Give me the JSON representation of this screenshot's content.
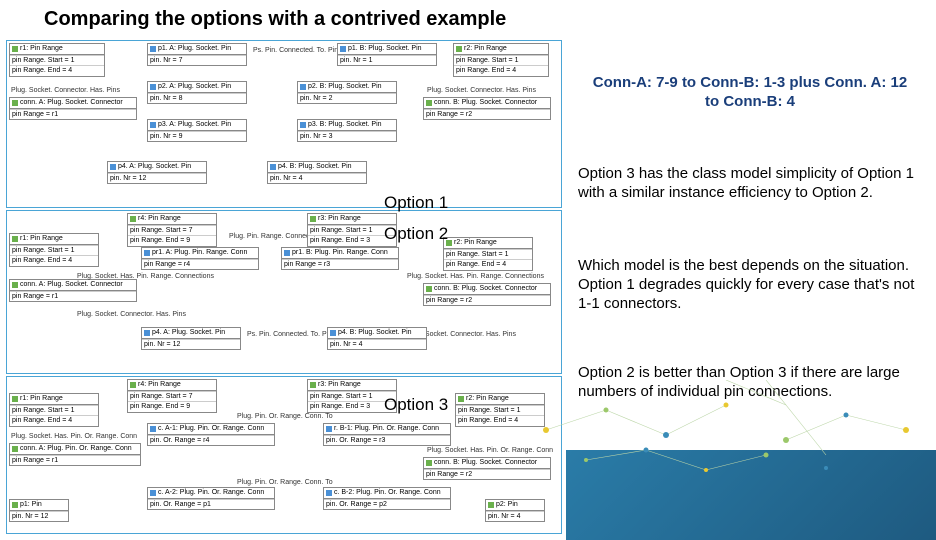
{
  "title": "Comparing the options with a contrived example",
  "summary": "Conn-A: 7-9 to Conn-B: 1-3 plus Conn. A: 12 to Conn-B: 4",
  "paragraph1": "Option 3 has the class model simplicity of Option 1 with a similar instance efficiency to Option 2.",
  "paragraph2": "Which model is the best depends on the situation. Option 1 degrades quickly for every case that's not 1-1 connectors.",
  "paragraph3": "Option 2 is better than Option 3 if there are large numbers of individual pin connections.",
  "option1": "Option 1",
  "option2": "Option 2",
  "option3": "Option 3",
  "diagrams": {
    "d1": {
      "r1": {
        "name": "r1: Pin Range",
        "slots": [
          "pin Range. Start = 1",
          "pin Range. End = 4"
        ]
      },
      "assoc1": "Plug. Socket. Connector. Has. Pins",
      "connA": {
        "name": "conn. A: Plug. Socket. Connector",
        "slot": "pin Range = r1"
      },
      "p1A": {
        "name": "p1. A: Plug. Socket. Pin",
        "slot": "pin. Nr = 7"
      },
      "p2A": {
        "name": "p2. A: Plug. Socket. Pin",
        "slot": "pin. Nr = 8"
      },
      "p3A": {
        "name": "p3. A: Plug. Socket. Pin",
        "slot": "pin. Nr = 9"
      },
      "p4A": {
        "name": "p4. A: Plug. Socket. Pin",
        "slot": "pin. Nr = 12"
      },
      "r2": {
        "name": "r2: Pin Range",
        "slots": [
          "pin Range. Start = 1",
          "pin Range. End = 4"
        ]
      },
      "assoc_mid": "Ps. Pin. Connected. To. Pin",
      "p1B": {
        "name": "p1. B: Plug. Socket. Pin",
        "slot": "pin. Nr = 1"
      },
      "p2B": {
        "name": "p2. B: Plug. Socket. Pin",
        "slot": "pin. Nr = 2"
      },
      "p3B": {
        "name": "p3. B: Plug. Socket. Pin",
        "slot": "pin. Nr = 3"
      },
      "p4B": {
        "name": "p4. B: Plug. Socket. Pin",
        "slot": "pin. Nr = 4"
      },
      "assoc2": "Plug. Socket. Connector. Has. Pins",
      "connB": {
        "name": "conn. B: Plug. Socket. Connector",
        "slot": "pin Range = r2"
      }
    },
    "d2": {
      "r1": {
        "name": "r1: Pin Range",
        "slots": [
          "pin Range. Start = 1",
          "pin Range. End = 4"
        ]
      },
      "connA": {
        "name": "conn. A: Plug. Socket. Connector",
        "slot": "pin Range = r1"
      },
      "r4": {
        "name": "r4: Pin Range",
        "slots": [
          "pin Range. Start = 7",
          "pin Range. End = 9"
        ]
      },
      "pr1A": {
        "name": "pr1. A: Plug. Pin. Range. Conn",
        "slot": "pin Range = r4"
      },
      "r3": {
        "name": "r3: Pin Range",
        "slots": [
          "pin Range. Start = 1",
          "pin Range. End = 3"
        ]
      },
      "pr1B": {
        "name": "pr1. B: Plug. Pin. Range. Conn",
        "slot": "pin Range = r3"
      },
      "r2": {
        "name": "r2: Pin Range",
        "slots": [
          "pin Range. Start = 1",
          "pin Range. End = 4"
        ]
      },
      "connB": {
        "name": "conn. B: Plug. Socket. Connector",
        "slot": "pin Range = r2"
      },
      "p4A": {
        "name": "p4. A: Plug. Socket. Pin",
        "slot": "pin. Nr = 12"
      },
      "p4B": {
        "name": "p4. B: Plug. Socket. Pin",
        "slot": "pin. Nr = 4"
      },
      "assoc_top": "Plug. Pin. Range. Connected. To. Range",
      "assoc_has_l": "Plug. Socket. Has. Pin. Range. Connections",
      "assoc_has_r": "Plug. Socket. Has. Pin. Range. Connections",
      "assoc_haspins_l": "Plug. Socket. Connector. Has. Pins",
      "assoc_haspins_r": "Plug. Socket. Connector. Has. Pins",
      "assoc_ps": "Ps. Pin. Connected. To. Pin"
    },
    "d3": {
      "r1": {
        "name": "r1: Pin Range",
        "slots": [
          "pin Range. Start = 1",
          "pin Range. End = 4"
        ]
      },
      "connA": {
        "name": "conn. A: Plug. Pin. Or. Range. Conn",
        "slot": "pin Range = r1"
      },
      "r4": {
        "name": "r4: Pin Range",
        "slots": [
          "pin Range. Start = 7",
          "pin Range. End = 9"
        ]
      },
      "cA1": {
        "name": "c. A-1: Plug. Pin. Or. Range. Conn",
        "slot": "pin. Or. Range = r4"
      },
      "r3": {
        "name": "r3: Pin Range",
        "slots": [
          "pin Range. Start = 1",
          "pin Range. End = 3"
        ]
      },
      "rB1": {
        "name": "r. B-1: Plug. Pin. Or. Range. Conn",
        "slot": "pin. Or. Range = r3"
      },
      "r2": {
        "name": "r2: Pin Range",
        "slots": [
          "pin Range. Start = 1",
          "pin Range. End = 4"
        ]
      },
      "connB": {
        "name": "conn. B: Plug. Socket. Connector",
        "slot": "pin Range = r2"
      },
      "cA2": {
        "name": "c. A-2: Plug. Pin. Or. Range. Conn",
        "slot": "pin. Or. Range = p1"
      },
      "cB2": {
        "name": "c. B-2: Plug. Pin. Or. Range. Conn",
        "slot": "pin. Or. Range = p2"
      },
      "p1": {
        "name": "p1: Pin",
        "slot": "pin. Nr = 12"
      },
      "p2": {
        "name": "p2: Pin",
        "slot": "pin. Nr = 4"
      },
      "assoc_top": "Plug. Pin. Or. Range. Conn. To",
      "assoc_has_l": "Plug. Socket. Has. Pin. Or. Range. Conn",
      "assoc_has_r": "Plug. Socket. Has. Pin. Or. Range. Conn",
      "assoc_bot": "Plug. Pin. Or. Range. Conn. To"
    }
  }
}
